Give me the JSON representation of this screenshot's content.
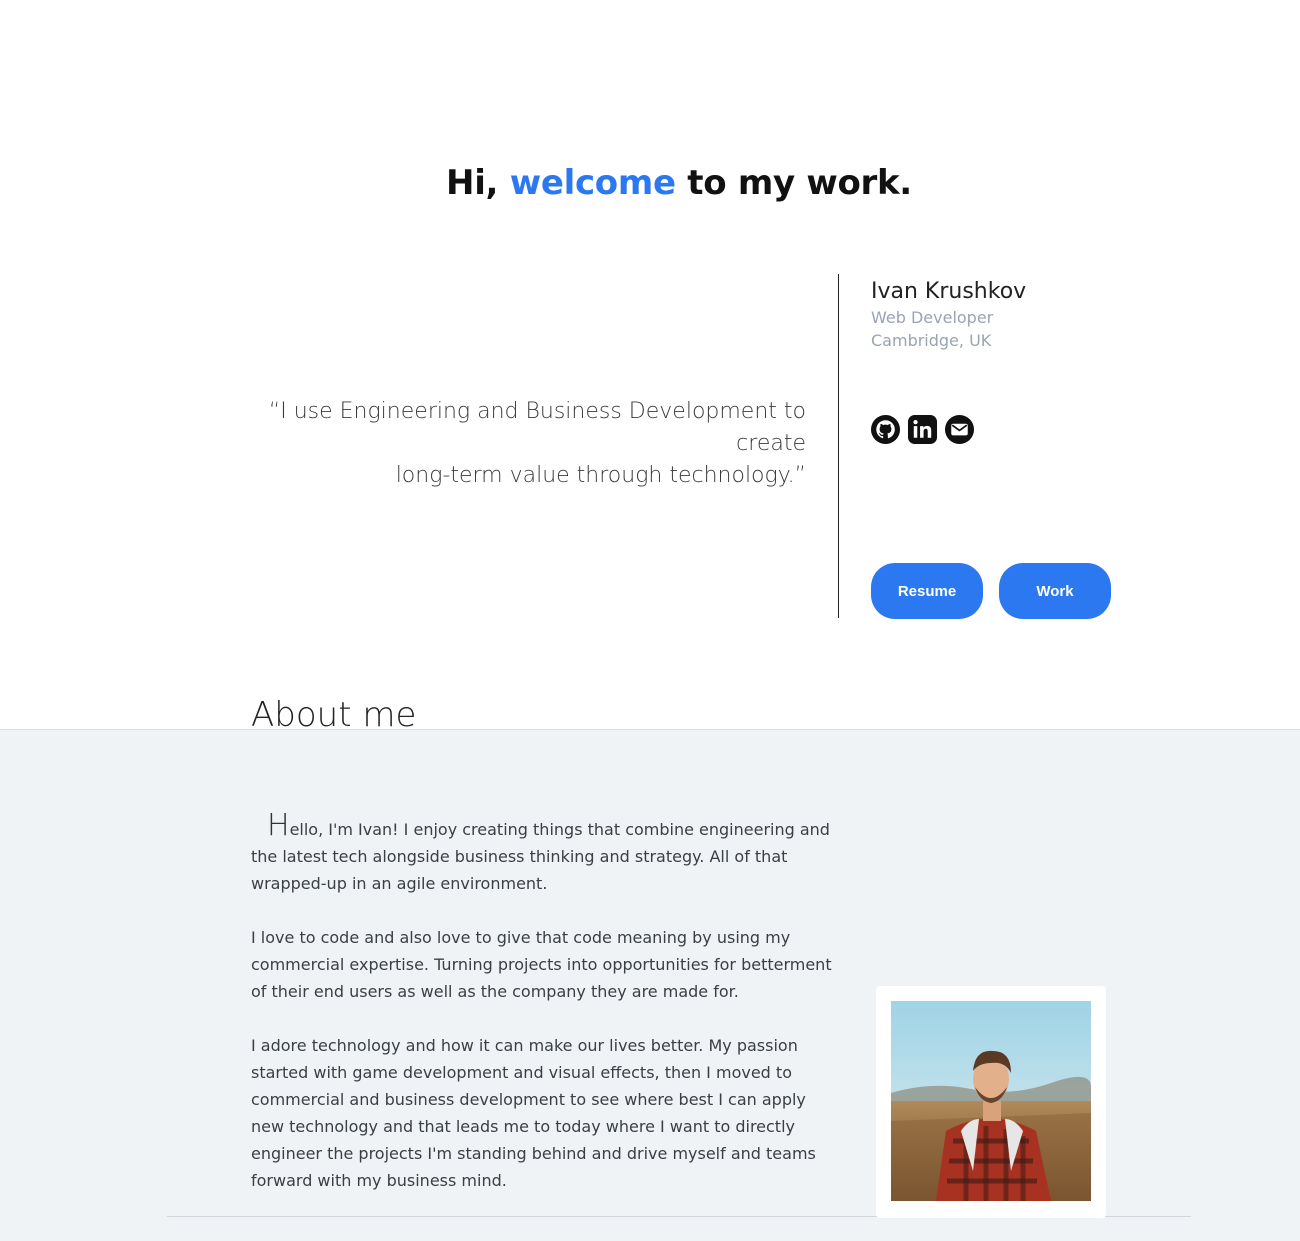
{
  "hero": {
    "title_prefix": "Hi, ",
    "title_accent": "welcome",
    "title_suffix": " to my work."
  },
  "quote": {
    "line1": "“I use Engineering and Business Development to create",
    "line2": "long-term value through technology.”"
  },
  "profile": {
    "name": "Ivan Krushkov",
    "role": "Web Developer",
    "location": "Cambridge, UK"
  },
  "socials": [
    {
      "icon": "github-icon"
    },
    {
      "icon": "linkedin-icon"
    },
    {
      "icon": "mail-icon"
    }
  ],
  "buttons": {
    "resume": "Resume",
    "work": "Work"
  },
  "about": {
    "heading": "About me",
    "dropcap": "H",
    "p1_rest": "ello, I'm Ivan! I enjoy creating things that combine engineering and the latest tech alongside business thinking and strategy. All of that wrapped-up in an agile environment.",
    "p2": "I love to code and also love to give that code meaning by using my commercial expertise. Turning projects into opportunities for betterment of their end users as well as the company they are made for.",
    "p3": "I adore technology and how it can make our lives better. My passion started with game development and visual effects, then I moved to commercial and business development to see where best I can apply new technology and that leads me to today where I want to directly engineer the projects I'm standing behind and drive myself and teams forward with my business mind."
  },
  "colors": {
    "accent": "#2b78f0",
    "about_bg": "#f0f3f6",
    "muted": "#9aa4b2"
  }
}
